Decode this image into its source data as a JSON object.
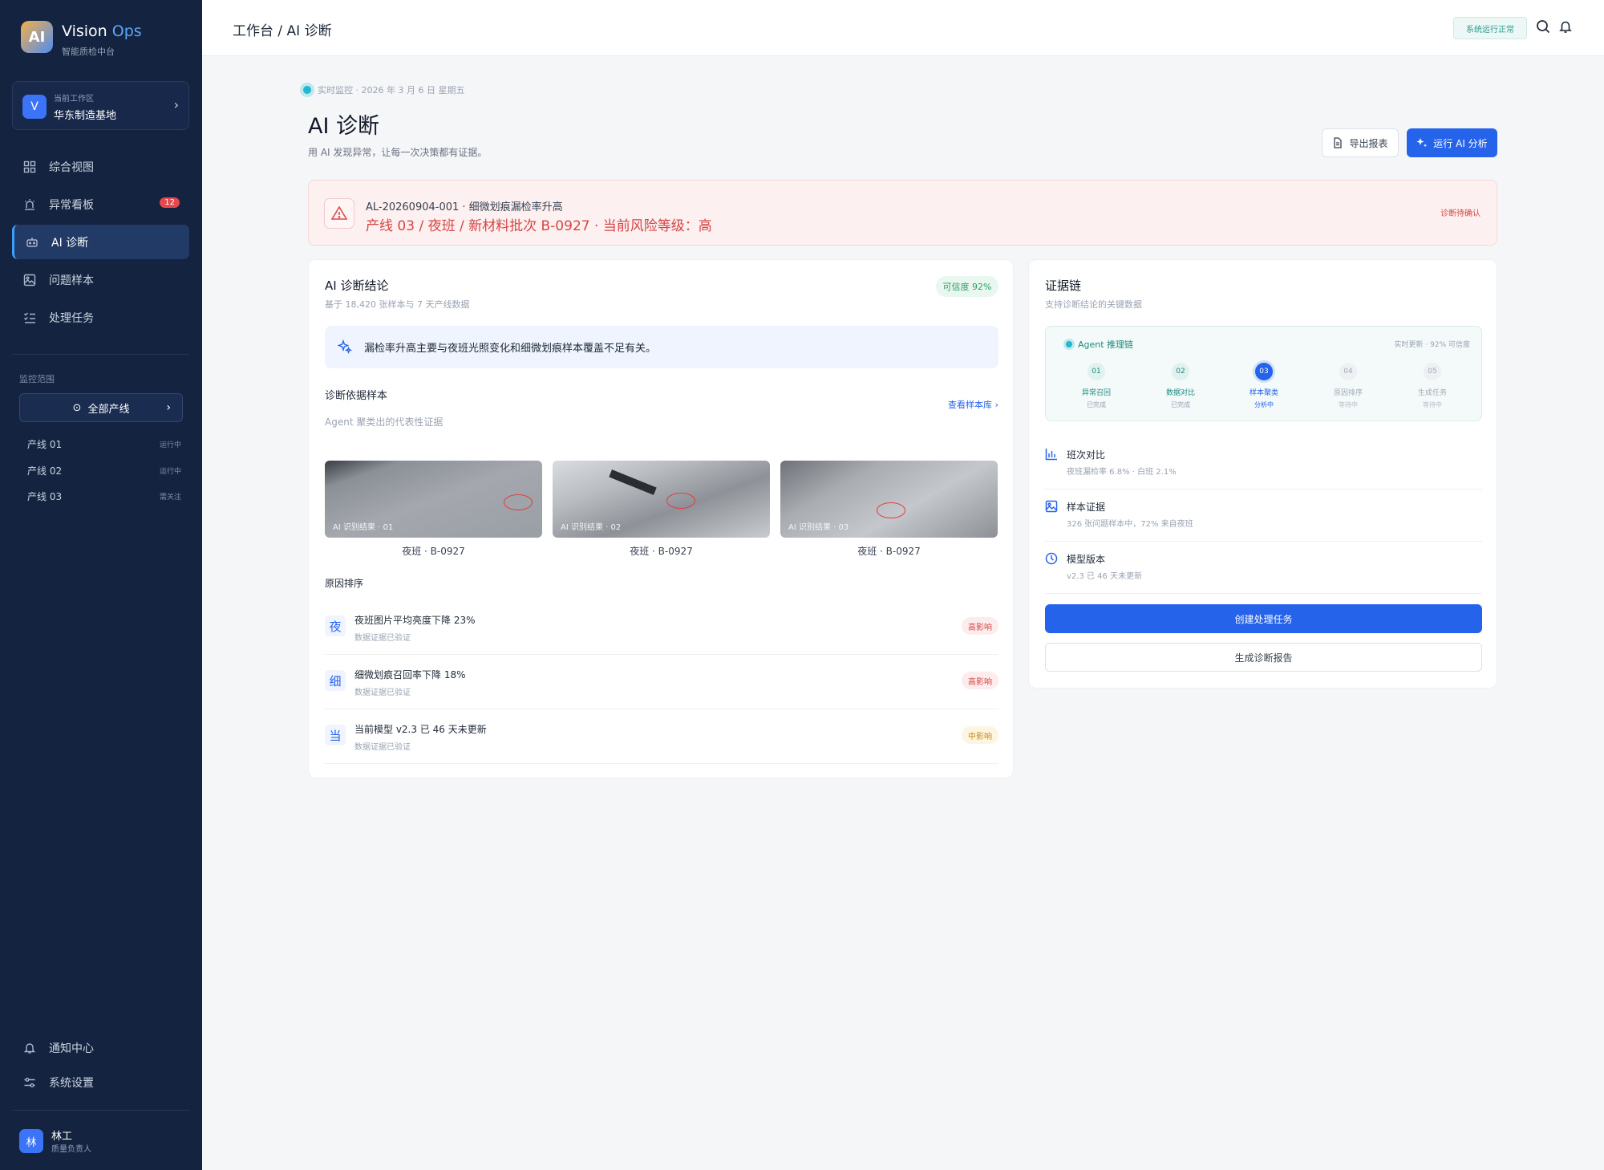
{
  "brand": {
    "logo_text": "AI",
    "name": "Vision",
    "name_accent": "Ops",
    "subtitle": "智能质检中台"
  },
  "workspace": {
    "avatar": "V",
    "label": "当前工作区",
    "name": "华东制造基地"
  },
  "nav": [
    {
      "label": "综合视图",
      "icon": "grid-icon"
    },
    {
      "label": "异常看板",
      "icon": "alarm-icon",
      "badge": "12"
    },
    {
      "label": "AI 诊断",
      "icon": "robot-icon",
      "active": true
    },
    {
      "label": "问题样本",
      "icon": "image-icon"
    },
    {
      "label": "处理任务",
      "icon": "checklist-icon"
    }
  ],
  "scope": {
    "label": "监控范围",
    "all_lines": "全部产线",
    "lines": [
      {
        "name": "产线 01",
        "status": "运行中"
      },
      {
        "name": "产线 02",
        "status": "运行中"
      },
      {
        "name": "产线 03",
        "status": "需关注"
      }
    ]
  },
  "footer_nav": [
    {
      "label": "通知中心",
      "icon": "bell-icon"
    },
    {
      "label": "系统设置",
      "icon": "sliders-icon"
    }
  ],
  "user": {
    "avatar": "林",
    "name": "林工",
    "role": "质量负责人"
  },
  "header": {
    "breadcrumb": "工作台 / AI 诊断",
    "status": "系统运行正常"
  },
  "page": {
    "live": "实时监控 · 2026 年 3 月 6 日 星期五",
    "title": "AI 诊断",
    "subtitle": "用 AI 发现异常，让每一次决策都有证据。",
    "export_label": "导出报表",
    "run_label": "运行 AI 分析"
  },
  "alert": {
    "id": "AL-20260904-001 · 细微划痕漏检率升高",
    "main": "产线 03 / 夜班 / 新材料批次 B-0927 · 当前风险等级：高",
    "badge": "诊断待确认"
  },
  "conclusion": {
    "title": "AI 诊断结论",
    "subtitle": "基于 18,420 张样本与 7 天产线数据",
    "confidence": "可信度 92%",
    "text": "漏检率升高主要与夜班光照变化和细微划痕样本覆盖不足有关。",
    "samples_title": "诊断依据样本",
    "samples_sub": "Agent 聚类出的代表性证据",
    "samples_link": "查看样本库",
    "samples": [
      {
        "caption": "AI 识别结果 · 01",
        "label": "夜班 · B-0927"
      },
      {
        "caption": "AI 识别结果 · 02",
        "label": "夜班 · B-0927"
      },
      {
        "caption": "AI 识别结果 · 03",
        "label": "夜班 · B-0927"
      }
    ],
    "reasons_title": "原因排序",
    "reasons": [
      {
        "char": "夜",
        "title": "夜班图片平均亮度下降 23%",
        "verify": "数据证据已验证",
        "impact": "高影响",
        "level": "high"
      },
      {
        "char": "细",
        "title": "细微划痕召回率下降 18%",
        "verify": "数据证据已验证",
        "impact": "高影响",
        "level": "high"
      },
      {
        "char": "当",
        "title": "当前模型 v2.3 已 46 天未更新",
        "verify": "数据证据已验证",
        "impact": "中影响",
        "level": "mid"
      }
    ]
  },
  "evidence": {
    "title": "证据链",
    "subtitle": "支持诊断结论的关键数据",
    "chain_title": "Agent 推理链",
    "chain_meta": "实时更新 · 92% 可信度",
    "steps": [
      {
        "num": "01",
        "label": "异常召回",
        "status": "已完成",
        "state": "done"
      },
      {
        "num": "02",
        "label": "数据对比",
        "status": "已完成",
        "state": "done"
      },
      {
        "num": "03",
        "label": "样本聚类",
        "status": "分析中",
        "state": "active"
      },
      {
        "num": "04",
        "label": "原因排序",
        "status": "等待中",
        "state": "wait"
      },
      {
        "num": "05",
        "label": "生成任务",
        "status": "等待中",
        "state": "wait"
      }
    ],
    "items": [
      {
        "icon": "bar-chart-icon",
        "title": "班次对比",
        "sub": "夜班漏检率 6.8% · 白班 2.1%"
      },
      {
        "icon": "image-icon",
        "title": "样本证据",
        "sub": "326 张问题样本中，72% 来自夜班"
      },
      {
        "icon": "clock-icon",
        "title": "模型版本",
        "sub": "v2.3 已 46 天未更新"
      }
    ],
    "create_label": "创建处理任务",
    "report_label": "生成诊断报告"
  }
}
